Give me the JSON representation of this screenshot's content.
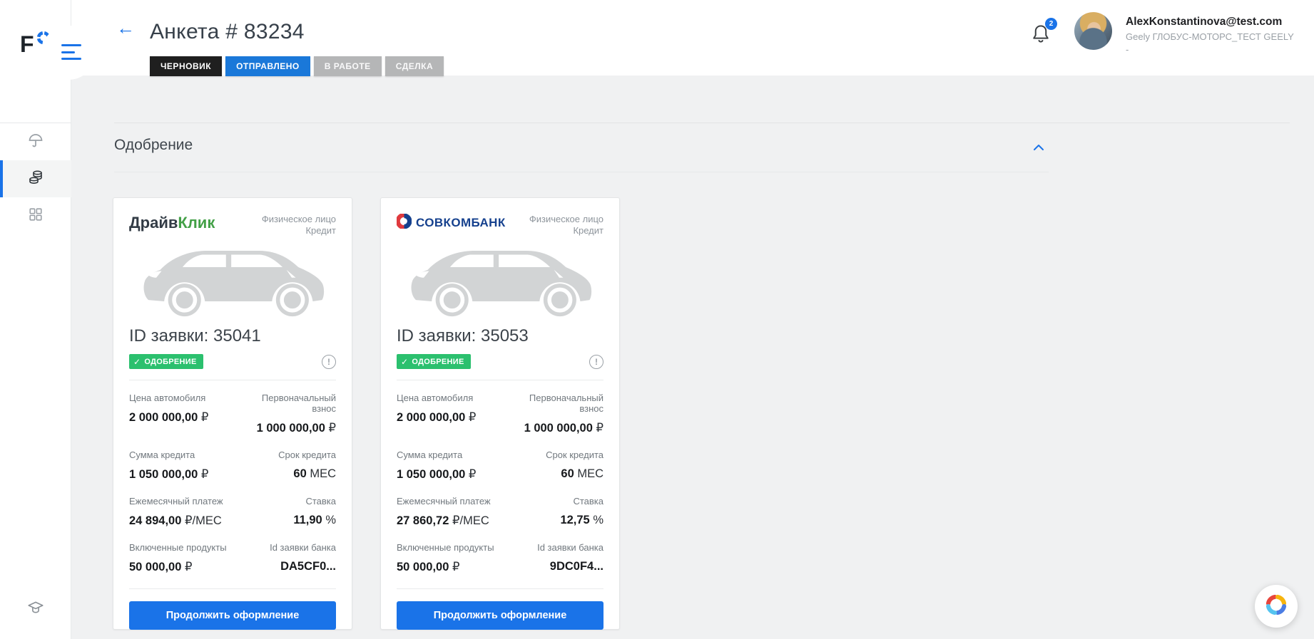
{
  "logo": {
    "letter": "F"
  },
  "header": {
    "title": "Анкета # 83234",
    "statuses": [
      {
        "label": "ЧЕРНОВИК"
      },
      {
        "label": "ОТПРАВЛЕНО"
      },
      {
        "label": "В РАБОТЕ"
      },
      {
        "label": "СДЕЛКА"
      }
    ],
    "notifications": {
      "count": "2"
    },
    "user": {
      "email": "AlexKonstantinova@test.com",
      "organization": "Geely ГЛОБУС-МОТОРС_ТЕСТ GEELY",
      "organization_extra": "-"
    }
  },
  "section": {
    "title": "Одобрение"
  },
  "cards": [
    {
      "bank": {
        "name_primary": "Драйв",
        "name_secondary": "Клик"
      },
      "offer_type_line1": "Физическое лицо",
      "offer_type_line2": "Кредит",
      "application": {
        "label": "ID заявки:",
        "id": "35041"
      },
      "status": {
        "check": "✓",
        "label": "ОДОБРЕНИЕ"
      },
      "info_icon": "!",
      "fields": [
        {
          "label": "Цена автомобиля",
          "value": "2 000 000,00",
          "unit": " ₽"
        },
        {
          "label": "Первоначальный взнос",
          "value": "1 000 000,00",
          "unit": " ₽"
        },
        {
          "label": "Сумма кредита",
          "value": "1 050 000,00",
          "unit": " ₽"
        },
        {
          "label": "Срок кредита",
          "value": "60",
          "unit": " МЕС"
        },
        {
          "label": "Ежемесячный платеж",
          "value": "24 894,00",
          "unit": " ₽/МЕС"
        },
        {
          "label": "Ставка",
          "value": "11,90",
          "unit": " %"
        },
        {
          "label": "Включенные продукты",
          "value": "50 000,00",
          "unit": " ₽"
        },
        {
          "label": "Id заявки банка",
          "value": "DA5CF0...",
          "unit": ""
        }
      ],
      "action": "Продолжить оформление"
    },
    {
      "bank": {
        "name": "СОВКОМБАНК"
      },
      "offer_type_line1": "Физическое лицо",
      "offer_type_line2": "Кредит",
      "application": {
        "label": "ID заявки:",
        "id": "35053"
      },
      "status": {
        "check": "✓",
        "label": "ОДОБРЕНИЕ"
      },
      "info_icon": "!",
      "fields": [
        {
          "label": "Цена автомобиля",
          "value": "2 000 000,00",
          "unit": " ₽"
        },
        {
          "label": "Первоначальный взнос",
          "value": "1 000 000,00",
          "unit": " ₽"
        },
        {
          "label": "Сумма кредита",
          "value": "1 050 000,00",
          "unit": " ₽"
        },
        {
          "label": "Срок кредита",
          "value": "60",
          "unit": " МЕС"
        },
        {
          "label": "Ежемесячный платеж",
          "value": "27 860,72",
          "unit": " ₽/МЕС"
        },
        {
          "label": "Ставка",
          "value": "12,75",
          "unit": " %"
        },
        {
          "label": "Включенные продукты",
          "value": "50 000,00",
          "unit": " ₽"
        },
        {
          "label": "Id заявки банка",
          "value": "9DC0F4...",
          "unit": ""
        }
      ],
      "action": "Продолжить оформление"
    }
  ],
  "colors": {
    "accent_blue": "#1a73e8",
    "status_sent_blue": "#1a78d9",
    "status_draft_black": "#1f1f1f",
    "status_inactive_gray": "#b5b6b7",
    "approve_green": "#2bc06e"
  }
}
